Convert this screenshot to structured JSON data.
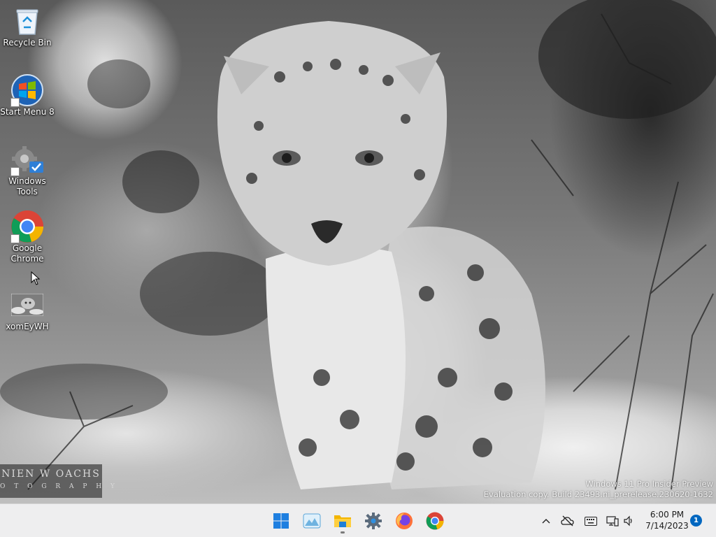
{
  "desktop": {
    "icons": [
      {
        "label": "Recycle Bin",
        "icon": "recycle-bin-icon"
      },
      {
        "label": "Start Menu 8",
        "icon": "start-menu-8-icon"
      },
      {
        "label": "Windows Tools",
        "icon": "windows-tools-icon"
      },
      {
        "label": "Google Chrome",
        "icon": "chrome-icon"
      },
      {
        "label": "xomEyWH",
        "icon": "image-file-icon"
      }
    ],
    "wallpaper": {
      "photographer_line1": "NIEN W OACHS",
      "photographer_line2": "O T O G R A P H Y"
    },
    "watermark": {
      "line1": "Windows 11 Pro Insider Preview",
      "line2": "Evaluation copy. Build 23493.ni_prerelease.230620-1632"
    }
  },
  "taskbar": {
    "apps": [
      {
        "name": "Start",
        "icon": "windows-start-icon"
      },
      {
        "name": "Widgets",
        "icon": "widgets-icon"
      },
      {
        "name": "File Explorer",
        "icon": "file-explorer-icon"
      },
      {
        "name": "Settings",
        "icon": "settings-gear-icon"
      },
      {
        "name": "Firefox",
        "icon": "firefox-icon"
      },
      {
        "name": "Google Chrome",
        "icon": "chrome-icon"
      }
    ],
    "tray": {
      "icons": [
        "chevron-up-icon",
        "onedrive-offline-icon",
        "keyboard-icon",
        "network-icon",
        "volume-icon"
      ],
      "time": "6:00 PM",
      "date": "7/14/2023",
      "notification_count": "1"
    }
  },
  "colors": {
    "taskbar_bg": "#eeeeef",
    "accent": "#0067c0",
    "chrome_red": "#db4437",
    "chrome_yellow": "#f4b400",
    "chrome_green": "#0f9d58",
    "chrome_blue": "#4285f4"
  }
}
